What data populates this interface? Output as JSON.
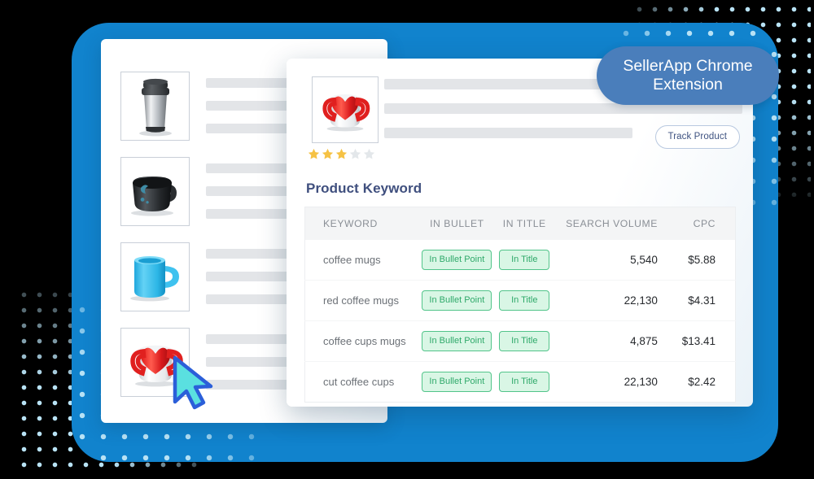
{
  "badge": {
    "line1": "SellerApp Chrome",
    "line2": "Extension"
  },
  "results_panel": {
    "items": [
      {
        "name": "travel-tumbler-thumbnail",
        "icon": "tumbler-icon"
      },
      {
        "name": "black-coffee-mug-thumbnail",
        "icon": "black-mug-icon"
      },
      {
        "name": "blue-coffee-mug-thumbnail",
        "icon": "blue-mug-icon"
      },
      {
        "name": "red-heart-coffee-mug-thumbnail",
        "icon": "red-heart-mug-icon"
      }
    ]
  },
  "detail_card": {
    "hero_image_icon": "red-heart-mug-icon",
    "rating": {
      "value": 3,
      "max": 5
    },
    "track_product_label": "Track Product",
    "section_title": "Product Keyword",
    "table": {
      "columns": [
        "KEYWORD",
        "IN BULLET",
        "IN TITLE",
        "SEARCH VOLUME",
        "CPC"
      ],
      "rows": [
        {
          "keyword": "coffee mugs",
          "in_bullet": "In Bullet Point",
          "in_title": "In Title",
          "search_volume": "5,540",
          "cpc": "$5.88"
        },
        {
          "keyword": "red coffee mugs",
          "in_bullet": "In Bullet Point",
          "in_title": "In Title",
          "search_volume": "22,130",
          "cpc": "$4.31"
        },
        {
          "keyword": "coffee cups mugs",
          "in_bullet": "In Bullet Point",
          "in_title": "In Title",
          "search_volume": "4,875",
          "cpc": "$13.41"
        },
        {
          "keyword": "cut coffee cups",
          "in_bullet": "In Bullet Point",
          "in_title": "In Title",
          "search_volume": "22,130",
          "cpc": "$2.42"
        }
      ]
    }
  },
  "colors": {
    "frame_blue": "#1183cd",
    "badge_blue": "#4a7ebb",
    "dot_light_blue": "#b8e2f5",
    "title_slate": "#3f4f7e",
    "pill_green_text": "#2fa96a",
    "pill_green_bg": "#d9f6e5",
    "pill_green_border": "#52c48a",
    "star_gold": "#f6c244",
    "star_empty": "#e3e7ea",
    "cursor_fill": "#5ae0e0",
    "cursor_stroke": "#2b5fd9"
  }
}
